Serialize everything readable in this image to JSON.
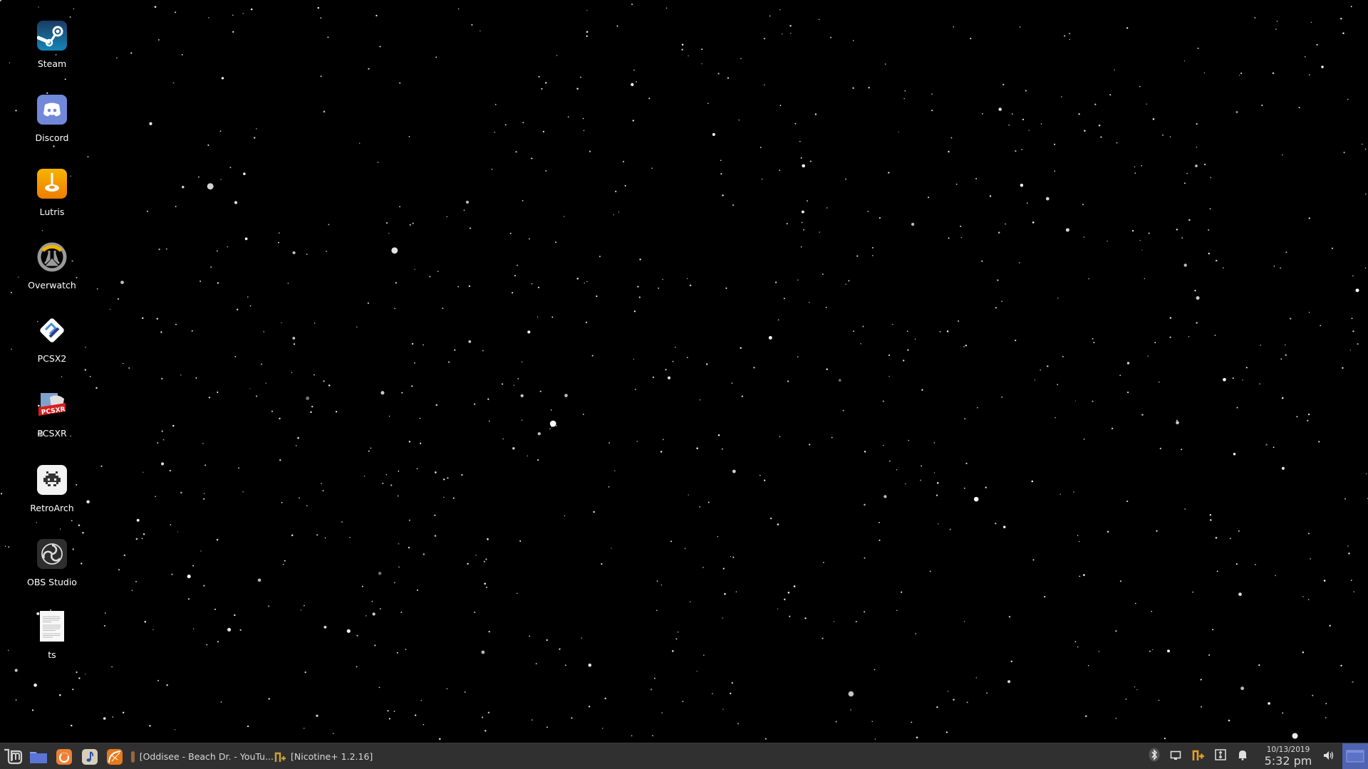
{
  "desktop": {
    "icons": [
      {
        "label": "Steam",
        "icon": "steam-icon"
      },
      {
        "label": "Discord",
        "icon": "discord-icon"
      },
      {
        "label": "Lutris",
        "icon": "lutris-icon"
      },
      {
        "label": "Overwatch",
        "icon": "overwatch-icon"
      },
      {
        "label": "PCSX2",
        "icon": "pcsx2-icon"
      },
      {
        "label": "PCSXR",
        "icon": "pcsxr-icon"
      },
      {
        "label": "RetroArch",
        "icon": "retroarch-icon"
      },
      {
        "label": "OBS Studio",
        "icon": "obs-icon"
      },
      {
        "label": "ts",
        "icon": "text-file-icon"
      }
    ]
  },
  "taskbar": {
    "launchers": [
      {
        "name": "menu",
        "icon": "mint-menu-icon"
      },
      {
        "name": "files",
        "icon": "folder-icon"
      },
      {
        "name": "firefox",
        "icon": "firefox-icon"
      },
      {
        "name": "music",
        "icon": "music-note-icon"
      },
      {
        "name": "mobile-broadband",
        "icon": "satellite-icon"
      }
    ],
    "windows": [
      {
        "title": "[Oddisee - Beach Dr. - YouTu...",
        "icon": "firefox-window-icon"
      },
      {
        "title": "[Nicotine+ 1.2.16]",
        "icon": "nicotine-icon"
      }
    ],
    "tray": [
      "bluetooth-icon",
      "display-icon",
      "nicotine-tray-icon",
      "update-manager-icon",
      "notifications-bell-icon",
      "volume-icon"
    ],
    "clock": {
      "date": "10/13/2019",
      "time": "5:32 pm"
    },
    "show_desktop": "show-desktop-button"
  },
  "colors": {
    "taskbar_bg": "#303030",
    "show_desktop": "#4f63b0",
    "nicotine_accent": "#e8a020"
  }
}
